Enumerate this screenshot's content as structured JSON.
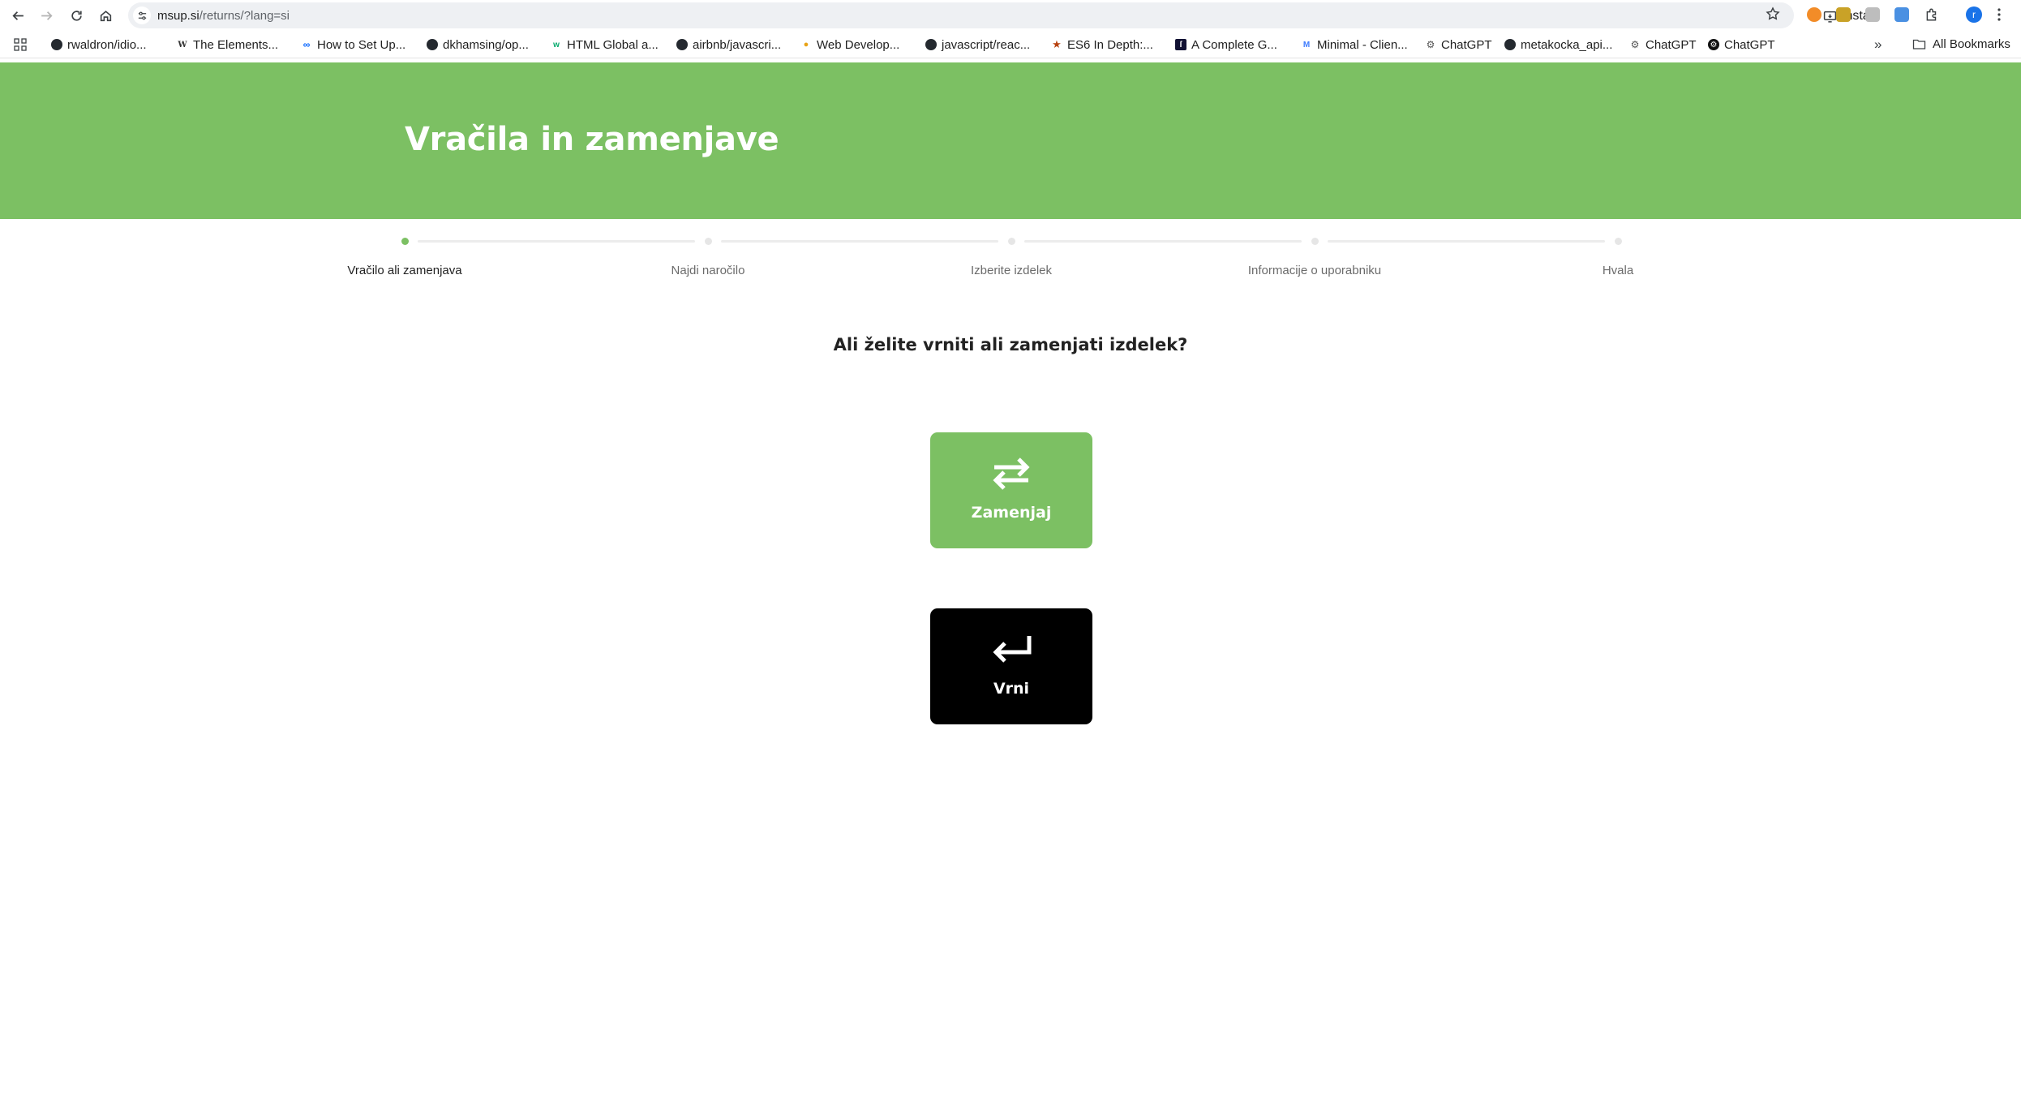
{
  "browser": {
    "url_host": "msup.si",
    "url_path": "/returns/?lang=si",
    "install_label": "Install",
    "profile_initial": "r",
    "bookmarks": [
      {
        "label": "rwaldron/idio...",
        "icon": "github-icon",
        "color": "#24292f"
      },
      {
        "label": "The Elements...",
        "icon": "wikipedia-icon",
        "color": "#444444"
      },
      {
        "label": "How to Set Up...",
        "icon": "meta-icon",
        "color": "#0866ff"
      },
      {
        "label": "dkhamsing/op...",
        "icon": "github-icon",
        "color": "#24292f"
      },
      {
        "label": "HTML Global a...",
        "icon": "w3schools-icon",
        "color": "#04aa6d"
      },
      {
        "label": "airbnb/javascri...",
        "icon": "github-icon",
        "color": "#24292f"
      },
      {
        "label": "Web Develop...",
        "icon": "bulb-icon",
        "color": "#e8a317"
      },
      {
        "label": "javascript/reac...",
        "icon": "github-icon",
        "color": "#24292f"
      },
      {
        "label": "ES6 In Depth:...",
        "icon": "star-bookmark-icon",
        "color": "#b7410e"
      },
      {
        "label": "A Complete G...",
        "icon": "guide-icon",
        "color": "#111133"
      },
      {
        "label": "Minimal - Clien...",
        "icon": "minimal-icon",
        "color": "#3d7bfd"
      },
      {
        "label": "ChatGPT",
        "icon": "chatgpt-icon",
        "color": "#555555"
      },
      {
        "label": "metakocka_api...",
        "icon": "github-icon",
        "color": "#24292f"
      },
      {
        "label": "ChatGPT",
        "icon": "chatgpt-icon",
        "color": "#555555"
      },
      {
        "label": "ChatGPT",
        "icon": "chatgpt-icon",
        "color": "#111111"
      }
    ],
    "more_label": "»",
    "all_bookmarks_label": "All Bookmarks"
  },
  "page": {
    "title": "Vračila in zamenjave",
    "accent_color": "#7cc063",
    "steps": [
      {
        "label": "Vračilo ali zamenjava",
        "active": true
      },
      {
        "label": "Najdi naročilo",
        "active": false
      },
      {
        "label": "Izberite izdelek",
        "active": false
      },
      {
        "label": "Informacije o uporabniku",
        "active": false
      },
      {
        "label": "Hvala",
        "active": false
      }
    ],
    "question": "Ali želite vrniti ali zamenjati izdelek?",
    "exchange_label": "Zamenjaj",
    "return_label": "Vrni"
  }
}
